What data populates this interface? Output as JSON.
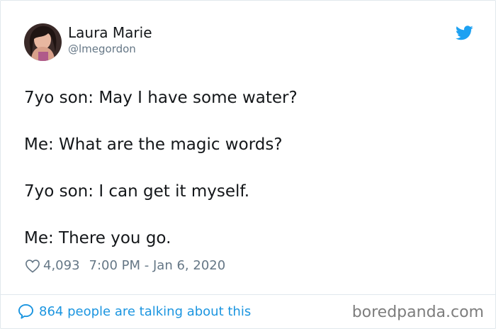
{
  "author": {
    "name": "Laura Marie",
    "handle": "@lmegordon"
  },
  "tweet": {
    "lines": [
      "7yo son: May I have some water?",
      "Me: What are the magic words?",
      "7yo son: I can get it myself.",
      "Me: There you go."
    ],
    "likes": "4,093",
    "timestamp": "7:00 PM - Jan 6, 2020",
    "talking": "864 people are talking about this"
  },
  "watermark": "boredpanda.com",
  "icons": {
    "brand": "twitter-bird-icon",
    "like": "heart-icon",
    "reply": "speech-bubble-icon"
  },
  "colors": {
    "brand_blue": "#1da1f2",
    "link_blue": "#1b95e0",
    "muted": "#657786",
    "text": "#14171a"
  }
}
